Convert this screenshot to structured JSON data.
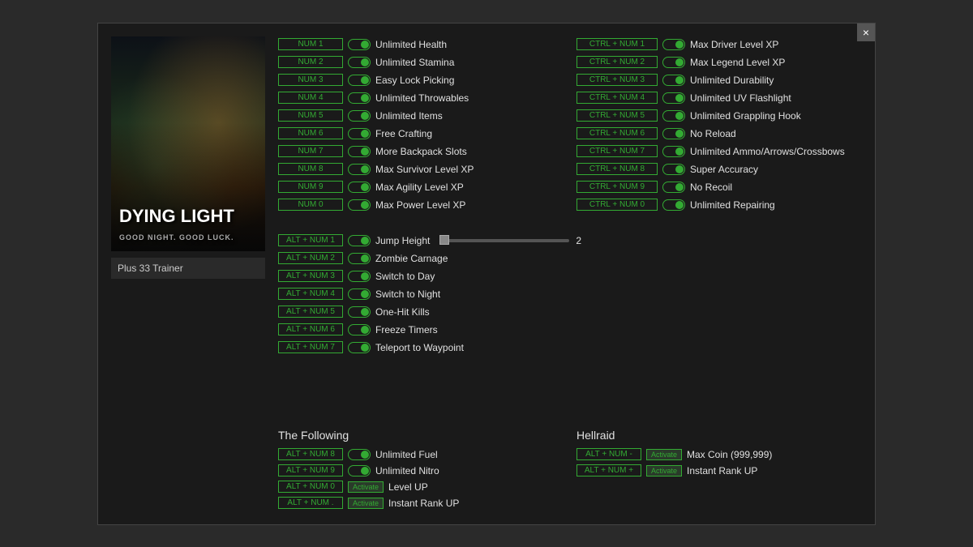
{
  "window": {
    "close_label": "×",
    "trainer_name": "Plus 33 Trainer",
    "game_title": "DYING LIGHT",
    "game_subtitle": "GOOD NIGHT. GOOD LUCK."
  },
  "col1": {
    "rows": [
      {
        "key": "NUM 1",
        "label": "Unlimited Health"
      },
      {
        "key": "NUM 2",
        "label": "Unlimited Stamina"
      },
      {
        "key": "NUM 3",
        "label": "Easy Lock Picking"
      },
      {
        "key": "NUM 4",
        "label": "Unlimited Throwables"
      },
      {
        "key": "NUM 5",
        "label": "Unlimited Items"
      },
      {
        "key": "NUM 6",
        "label": "Free Crafting"
      },
      {
        "key": "NUM 7",
        "label": "More Backpack Slots"
      },
      {
        "key": "NUM 8",
        "label": "Max Survivor Level XP"
      },
      {
        "key": "NUM 9",
        "label": "Max Agility Level XP"
      },
      {
        "key": "NUM 0",
        "label": "Max Power Level XP"
      }
    ]
  },
  "col2": {
    "rows": [
      {
        "key": "CTRL + NUM 1",
        "label": "Max Driver Level XP"
      },
      {
        "key": "CTRL + NUM 2",
        "label": "Max Legend Level XP"
      },
      {
        "key": "CTRL + NUM 3",
        "label": "Unlimited Durability"
      },
      {
        "key": "CTRL + NUM 4",
        "label": "Unlimited UV Flashlight"
      },
      {
        "key": "CTRL + NUM 5",
        "label": "Unlimited Grappling Hook"
      },
      {
        "key": "CTRL + NUM 6",
        "label": "No Reload"
      },
      {
        "key": "CTRL + NUM 7",
        "label": "Unlimited Ammo/Arrows/Crossbows"
      },
      {
        "key": "CTRL + NUM 8",
        "label": "Super Accuracy"
      },
      {
        "key": "CTRL + NUM 9",
        "label": "No Recoil"
      },
      {
        "key": "CTRL + NUM 0",
        "label": "Unlimited Repairing"
      }
    ]
  },
  "col3": {
    "rows": [
      {
        "key": "ALT + NUM 1",
        "label": "Jump Height",
        "has_slider": true,
        "slider_value": "2"
      },
      {
        "key": "ALT + NUM 2",
        "label": "Zombie Carnage"
      },
      {
        "key": "ALT + NUM 3",
        "label": "Switch to Day"
      },
      {
        "key": "ALT + NUM 4",
        "label": "Switch to Night"
      },
      {
        "key": "ALT + NUM 5",
        "label": "One-Hit Kills"
      },
      {
        "key": "ALT + NUM 6",
        "label": "Freeze Timers"
      },
      {
        "key": "ALT + NUM 7",
        "label": "Teleport to Waypoint"
      }
    ]
  },
  "following": {
    "title": "The Following",
    "rows": [
      {
        "key": "ALT + NUM 8",
        "label": "Unlimited Fuel",
        "type": "toggle"
      },
      {
        "key": "ALT + NUM 9",
        "label": "Unlimited Nitro",
        "type": "toggle"
      },
      {
        "key": "ALT + NUM 0",
        "label": "Level UP",
        "type": "activate"
      },
      {
        "key": "ALT + NUM .",
        "label": "Instant Rank UP",
        "type": "activate"
      }
    ],
    "activate_label": "Activate"
  },
  "hellraid": {
    "title": "Hellraid",
    "rows": [
      {
        "key": "ALT + NUM -",
        "label": "Max Coin (999,999)",
        "type": "activate"
      },
      {
        "key": "ALT + NUM +",
        "label": "Instant Rank UP",
        "type": "activate"
      }
    ],
    "activate_label": "Activate"
  }
}
